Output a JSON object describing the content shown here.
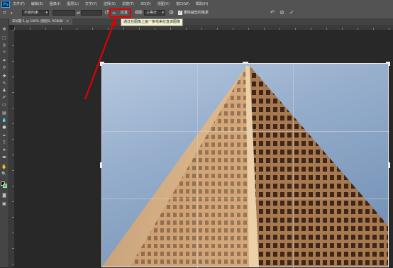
{
  "app": {
    "logo": "Ps"
  },
  "menu": [
    "文件(F)",
    "编辑(E)",
    "图像(I)",
    "图层(L)",
    "文字(Y)",
    "选择(S)",
    "滤镜(T)",
    "3D(D)",
    "视图(V)",
    "窗口(W)",
    "帮助(H)"
  ],
  "options": {
    "ratio_select": "不受约束",
    "straighten_label": "拉直",
    "view_label": "视图:",
    "view_select": "三等分",
    "delete_cropped_label": "删除裁剪的像素"
  },
  "tooltip": "通过在图像上画一条线来拉直该图像",
  "document": {
    "tab_title": "未标题-1 @ 100% (图层0, RGB/8)"
  },
  "colors": {
    "foreground": "#000000",
    "background": "#31d843",
    "highlight": "#e00000"
  }
}
